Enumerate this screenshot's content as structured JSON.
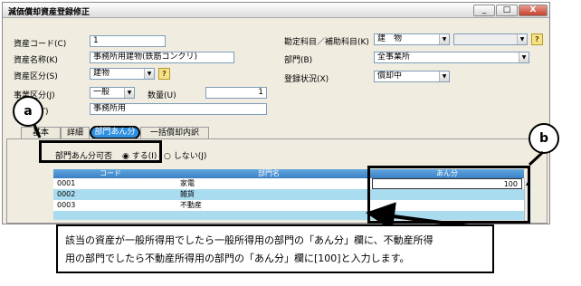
{
  "window": {
    "title": "減価償却資産登録修正",
    "min": "_",
    "max": "□",
    "close": "X"
  },
  "form": {
    "asset_code": {
      "label": "資産コード(C)",
      "value": "1"
    },
    "asset_name": {
      "label": "資産名称(K)",
      "value": "事務所用建物(鉄筋コンクリ)"
    },
    "asset_category": {
      "label": "資産区分(S)",
      "value": "建物"
    },
    "business_category": {
      "label": "事業区分(J)",
      "value": "一般"
    },
    "quantity": {
      "label": "数量(U)",
      "value": "1"
    },
    "summary": {
      "label": "摘要(T)",
      "value": "事務所用"
    },
    "account": {
      "label": "勘定科目／補助科目(K)",
      "value": "建　物",
      "sub_value": ""
    },
    "department": {
      "label": "部門(B)",
      "value": "全事業所"
    },
    "status": {
      "label": "登録状況(X)",
      "value": "償却中"
    }
  },
  "tabs": [
    "基本",
    "詳細",
    "部門あん分",
    "一括償却内訳"
  ],
  "allocation": {
    "label": "部門あん分可否",
    "option_yes": "する(I)",
    "option_no": "しない(J)",
    "headers": {
      "code": "コード",
      "name": "部門名",
      "share": "あん分"
    },
    "rows": [
      {
        "code": "0001",
        "name": "家電",
        "share": "100"
      },
      {
        "code": "0002",
        "name": "雑貨",
        "share": ""
      },
      {
        "code": "0003",
        "name": "不動産",
        "share": ""
      }
    ]
  },
  "annotations": {
    "a": "a",
    "b": "b"
  },
  "callout": {
    "line1": "該当の資産が一般所得用でしたら一般所得用の部門の「あん分」欄に、不動産所得",
    "line2": "用の部門でしたら不動産所得用の部門の「あん分」欄に[100]と入力します。"
  }
}
